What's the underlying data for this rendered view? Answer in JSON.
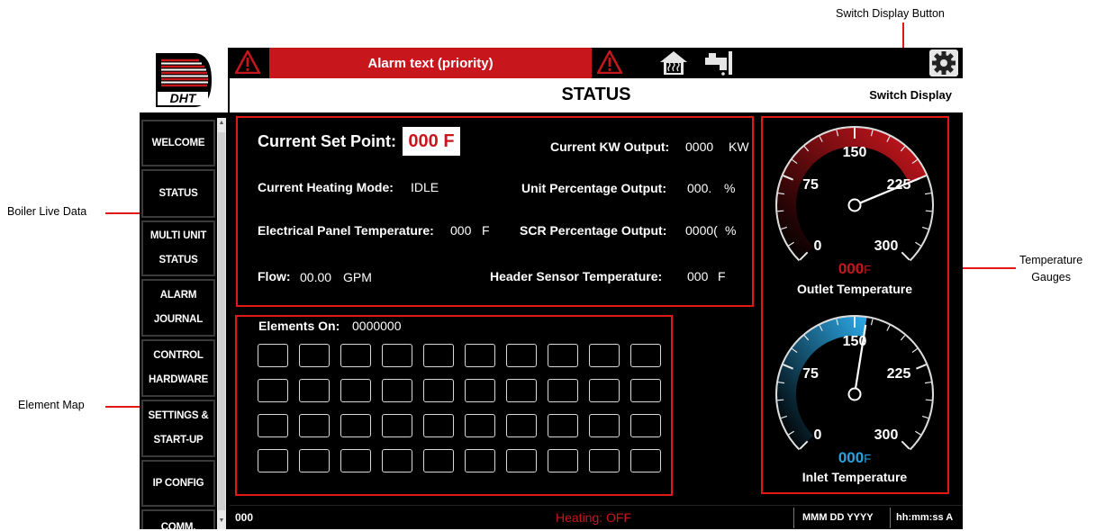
{
  "callouts": {
    "switch_display_button": "Switch Display Button",
    "boiler_live_data": "Boiler Live Data",
    "element_map": "Element Map",
    "temperature_gauges_line1": "Temperature",
    "temperature_gauges_line2": "Gauges"
  },
  "header": {
    "logo_text": "DHT",
    "alarm_text": "Alarm text (priority)",
    "page_title": "STATUS",
    "switch_display": "Switch Display"
  },
  "sidebar": {
    "items": [
      {
        "line1": "WELCOME",
        "line2": ""
      },
      {
        "line1": "STATUS",
        "line2": ""
      },
      {
        "line1": "MULTI UNIT",
        "line2": "STATUS"
      },
      {
        "line1": "ALARM",
        "line2": "JOURNAL"
      },
      {
        "line1": "CONTROL",
        "line2": "HARDWARE"
      },
      {
        "line1": "SETTINGS &",
        "line2": "START-UP"
      },
      {
        "line1": "IP CONFIG",
        "line2": ""
      },
      {
        "line1": "COMM.",
        "line2": ""
      }
    ]
  },
  "live_data": {
    "set_point_label": "Current Set Point:",
    "set_point_value": "000  F",
    "kw_label": "Current KW Output:",
    "kw_value": "0000",
    "kw_unit": "KW",
    "heating_mode_label": "Current Heating Mode:",
    "heating_mode_value": "IDLE",
    "unit_pct_label": "Unit Percentage Output:",
    "unit_pct_value": "000.",
    "unit_pct_unit": "%",
    "panel_temp_label": "Electrical Panel Temperature:",
    "panel_temp_value": "000",
    "panel_temp_unit": "F",
    "scr_pct_label": "SCR Percentage Output:",
    "scr_pct_value": "0000(",
    "scr_pct_unit": "%",
    "flow_label": "Flow:",
    "flow_value": "00.00",
    "flow_unit": "GPM",
    "header_temp_label": "Header Sensor Temperature:",
    "header_temp_value": "000",
    "header_temp_unit": "F"
  },
  "elements": {
    "label": "Elements On:",
    "value": "0000000",
    "rows": 4,
    "cols": 10
  },
  "gauges": {
    "outlet": {
      "title": "Outlet Temperature",
      "value": "000",
      "unit": "F",
      "tick_labels": [
        "0",
        "75",
        "150",
        "225",
        "300"
      ],
      "color": "#c8161d",
      "needle_value": 225
    },
    "inlet": {
      "title": "Inlet Temperature",
      "value": "000",
      "unit": "F",
      "tick_labels": [
        "0",
        "75",
        "150",
        "225",
        "300"
      ],
      "color": "#2aa3df",
      "needle_value": 160
    }
  },
  "status_bar": {
    "left_value": "000",
    "heating_status": "Heating: OFF",
    "date": "MMM DD YYYY",
    "time": "hh:mm:ss A"
  },
  "colors": {
    "accent_red": "#c8161d",
    "callout_red": "#e01818",
    "inlet_blue": "#2aa3df"
  }
}
